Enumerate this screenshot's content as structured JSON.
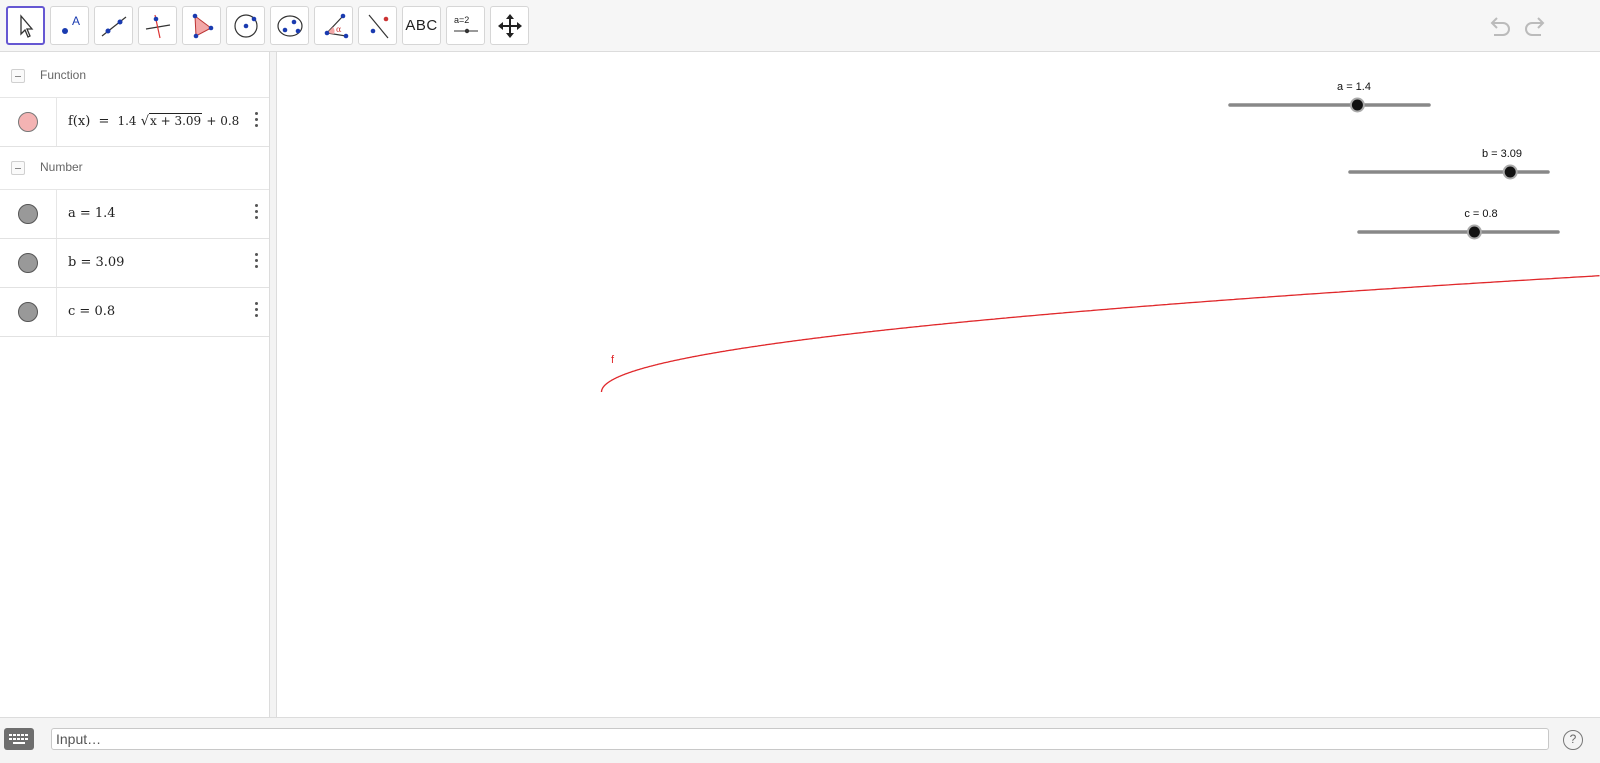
{
  "toolbar": {
    "tools": [
      {
        "name": "move-tool",
        "icon": "arrow-cursor-icon"
      },
      {
        "name": "point-tool",
        "icon": "point-icon",
        "label": "A"
      },
      {
        "name": "line-tool",
        "icon": "line-through-two-points-icon"
      },
      {
        "name": "perpendicular-line-tool",
        "icon": "perpendicular-line-icon"
      },
      {
        "name": "polygon-tool",
        "icon": "polygon-icon"
      },
      {
        "name": "circle-center-point-tool",
        "icon": "circle-center-icon"
      },
      {
        "name": "ellipse-tool",
        "icon": "ellipse-icon"
      },
      {
        "name": "angle-tool",
        "icon": "angle-icon",
        "label": "α"
      },
      {
        "name": "reflect-tool",
        "icon": "reflect-about-line-icon"
      },
      {
        "name": "text-tool",
        "icon": "text-icon",
        "label": "ABC"
      },
      {
        "name": "slider-tool",
        "icon": "slider-icon",
        "label": "a=2"
      },
      {
        "name": "move-graphics-view-tool",
        "icon": "move-arrows-icon"
      }
    ],
    "undo_icon": "undo-icon",
    "redo_icon": "redo-icon"
  },
  "algebra": {
    "function_group": {
      "label": "Function"
    },
    "function_row": {
      "lhs": "f(x)",
      "eq": "=",
      "coef": "1.4",
      "radicand": "x + 3.09",
      "tail": "+ 0.8",
      "color": "#f4b3b3"
    },
    "number_group": {
      "label": "Number"
    },
    "numbers": [
      {
        "name": "a",
        "value": "1.4",
        "text": "a = 1.4"
      },
      {
        "name": "b",
        "value": "3.09",
        "text": "b = 3.09"
      },
      {
        "name": "c",
        "value": "0.8",
        "text": "c = 0.8"
      }
    ],
    "number_marble_color": "#999999"
  },
  "graphics": {
    "curve_color": "#e0282b",
    "curve_label": "f",
    "sliders": [
      {
        "label": "a = 1.4",
        "value": 1.4,
        "min": -5,
        "max": 5
      },
      {
        "label": "b = 3.09",
        "value": 3.09,
        "min": -5,
        "max": 5
      },
      {
        "label": "c = 0.8",
        "value": 0.8,
        "min": -5,
        "max": 5
      }
    ]
  },
  "input": {
    "placeholder": "Input…",
    "keyboard_icon": "keyboard-icon",
    "help_icon": "help-icon",
    "help_text": "?"
  }
}
